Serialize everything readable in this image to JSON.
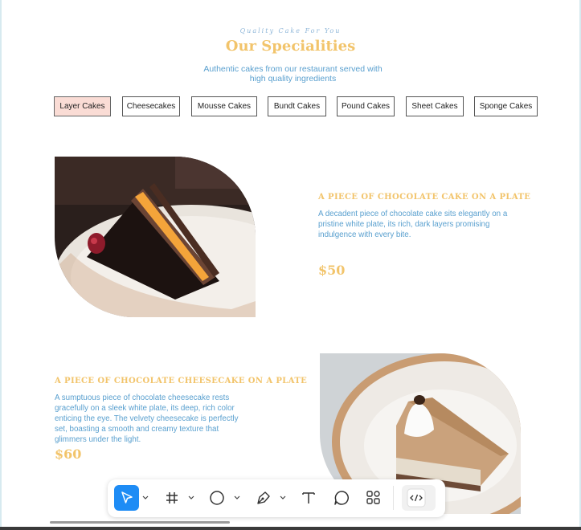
{
  "header": {
    "tagline": "Quality Cake For You",
    "title": "Our Specialities",
    "subtitle": "Authentic cakes from our restaurant served with high quality ingredients"
  },
  "tabs": [
    {
      "label": "Layer Cakes",
      "active": true
    },
    {
      "label": "Cheesecakes",
      "active": false
    },
    {
      "label": "Mousse Cakes",
      "active": false
    },
    {
      "label": "Bundt Cakes",
      "active": false
    },
    {
      "label": "Pound Cakes",
      "active": false
    },
    {
      "label": "Sheet Cakes",
      "active": false
    },
    {
      "label": "Sponge Cakes",
      "active": false
    }
  ],
  "products": [
    {
      "title": "A PIECE OF CHOCOLATE CAKE ON A PLATE",
      "description": "A decadent piece of chocolate cake sits elegantly on a pristine white plate, its rich, dark layers promising indulgence with every bite.",
      "price": "$50"
    },
    {
      "title": "A PIECE OF CHOCOLATE CHEESECAKE ON A PLATE",
      "description": "A sumptuous piece of chocolate cheesecake rests gracefully on a sleek white plate, its deep, rich color enticing the eye. The velvety cheesecake is perfectly set, boasting a smooth and creamy texture that glimmers under the light.",
      "price": "$60"
    }
  ],
  "toolbar": {
    "tools": [
      "move-tool",
      "frame-tool",
      "shape-tool",
      "pen-tool",
      "text-tool",
      "comment-tool",
      "actions-tool",
      "dev-mode-toggle"
    ]
  },
  "colors": {
    "accent_gold": "#f2c46b",
    "text_blue": "#5aa0cf",
    "active_tab": "#fadcd5",
    "tool_active": "#1e8cf5"
  }
}
